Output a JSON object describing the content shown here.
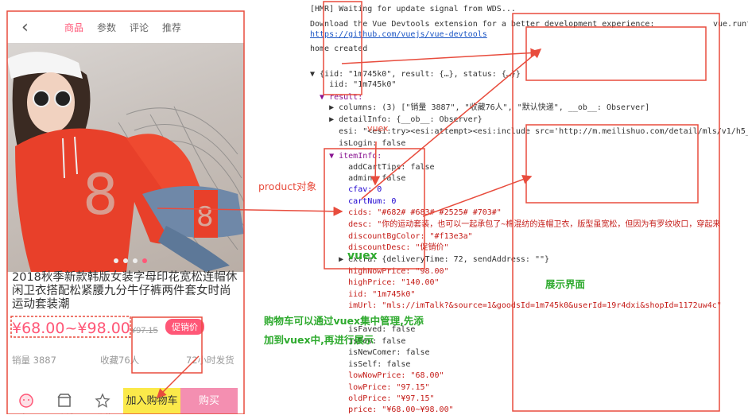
{
  "phone": {
    "back_icon": "chevron-left-icon",
    "tabs": [
      {
        "label": "商品",
        "active": true
      },
      {
        "label": "参数",
        "active": false
      },
      {
        "label": "评论",
        "active": false
      },
      {
        "label": "推荐",
        "active": false
      }
    ],
    "product_title": "2018秋季新款韩版女装字母印花宽松连帽休闲卫衣搭配松紧腰九分牛仔裤两件套女时尚运动套装潮",
    "price": "¥68.00~¥98.00",
    "old_price": "¥97.15",
    "promo_badge": "促销价",
    "sales": "销量 3887",
    "favorites": "收藏76人",
    "shipping": "72小时发货",
    "bottom_items": [
      "客服",
      "店铺",
      "收藏"
    ],
    "add_to_cart": "加入购物车",
    "buy": "购买"
  },
  "console": {
    "lines": [
      "[HMR] Waiting for update signal from WDS...",
      "Download the Vue Devtools extension for a better development experience:",
      "https://github.com/vuejs/vue-devtools",
      "home created",
      "▼ {iid: \"1m745k0\", result: {…}, status: {…}}",
      "    iid: \"1m745k0\"",
      "  ▼ result:",
      "    ▶ columns: (3) [\"销量 3887\", \"收藏76人\", \"默认快递\", __ob__: Observer]",
      "    ▶ detailInfo: {__ob__: Observer}",
      "      esi: \"<esi:try><esi:attempt><esi:include src='http://m.meilishuo.com/detail/mls/v1/h5_",
      "      isLogin: false",
      "    ▼ itemInfo:",
      "        addCartTips: false",
      "        admin: false",
      "        cfav: 0",
      "        cartNum: 0",
      "        cids: \"#682# #683# #2525# #703#\"",
      "        desc: \"你的运动套装，也可以一起承包了~棉混纺的连帽卫衣，版型虽宽松，但因为有罗纹收口，穿起来",
      "        discountBgColor: \"#f13e3a\"",
      "        discountDesc: \"促销价\"",
      "      ▶ extra: {deliveryTime: 72, sendAddress: \"\"}",
      "        highNowPrice: \"98.00\"",
      "        highPrice: \"140.00\"",
      "        iid: \"1m745k0\"",
      "        imUrl: \"mls://imTalk?&source=1&goodsId=1m745k0&userId=19r4dxi&shopId=1172uw4c\"",
      "        isFaved: false",
      "        isFew: false",
      "        isNewComer: false",
      "        isSelf: false",
      "        lowNowPrice: \"68.00\"",
      "        lowPrice: \"97.15\"",
      "        oldPrice: \"¥97.15\"",
      "        price: \"¥68.00~¥98.00\""
    ],
    "vue_link": "vue.runt"
  },
  "annotations": {
    "product_obj": "product对象",
    "vuex_small": "vuex",
    "vuex_big": "vuex",
    "display_ui": "展示界面",
    "cart_note_1": "购物车可以通过vuex集中管理,先添",
    "cart_note_2": "加到vuex中,再进行展示"
  },
  "colors": {
    "accent_pink": "#ff5777",
    "annotation_red": "#e84c3d",
    "annotation_green": "#2eaa2e",
    "cart_yellow": "#fbe94a",
    "buy_pink": "#f48fb1"
  }
}
